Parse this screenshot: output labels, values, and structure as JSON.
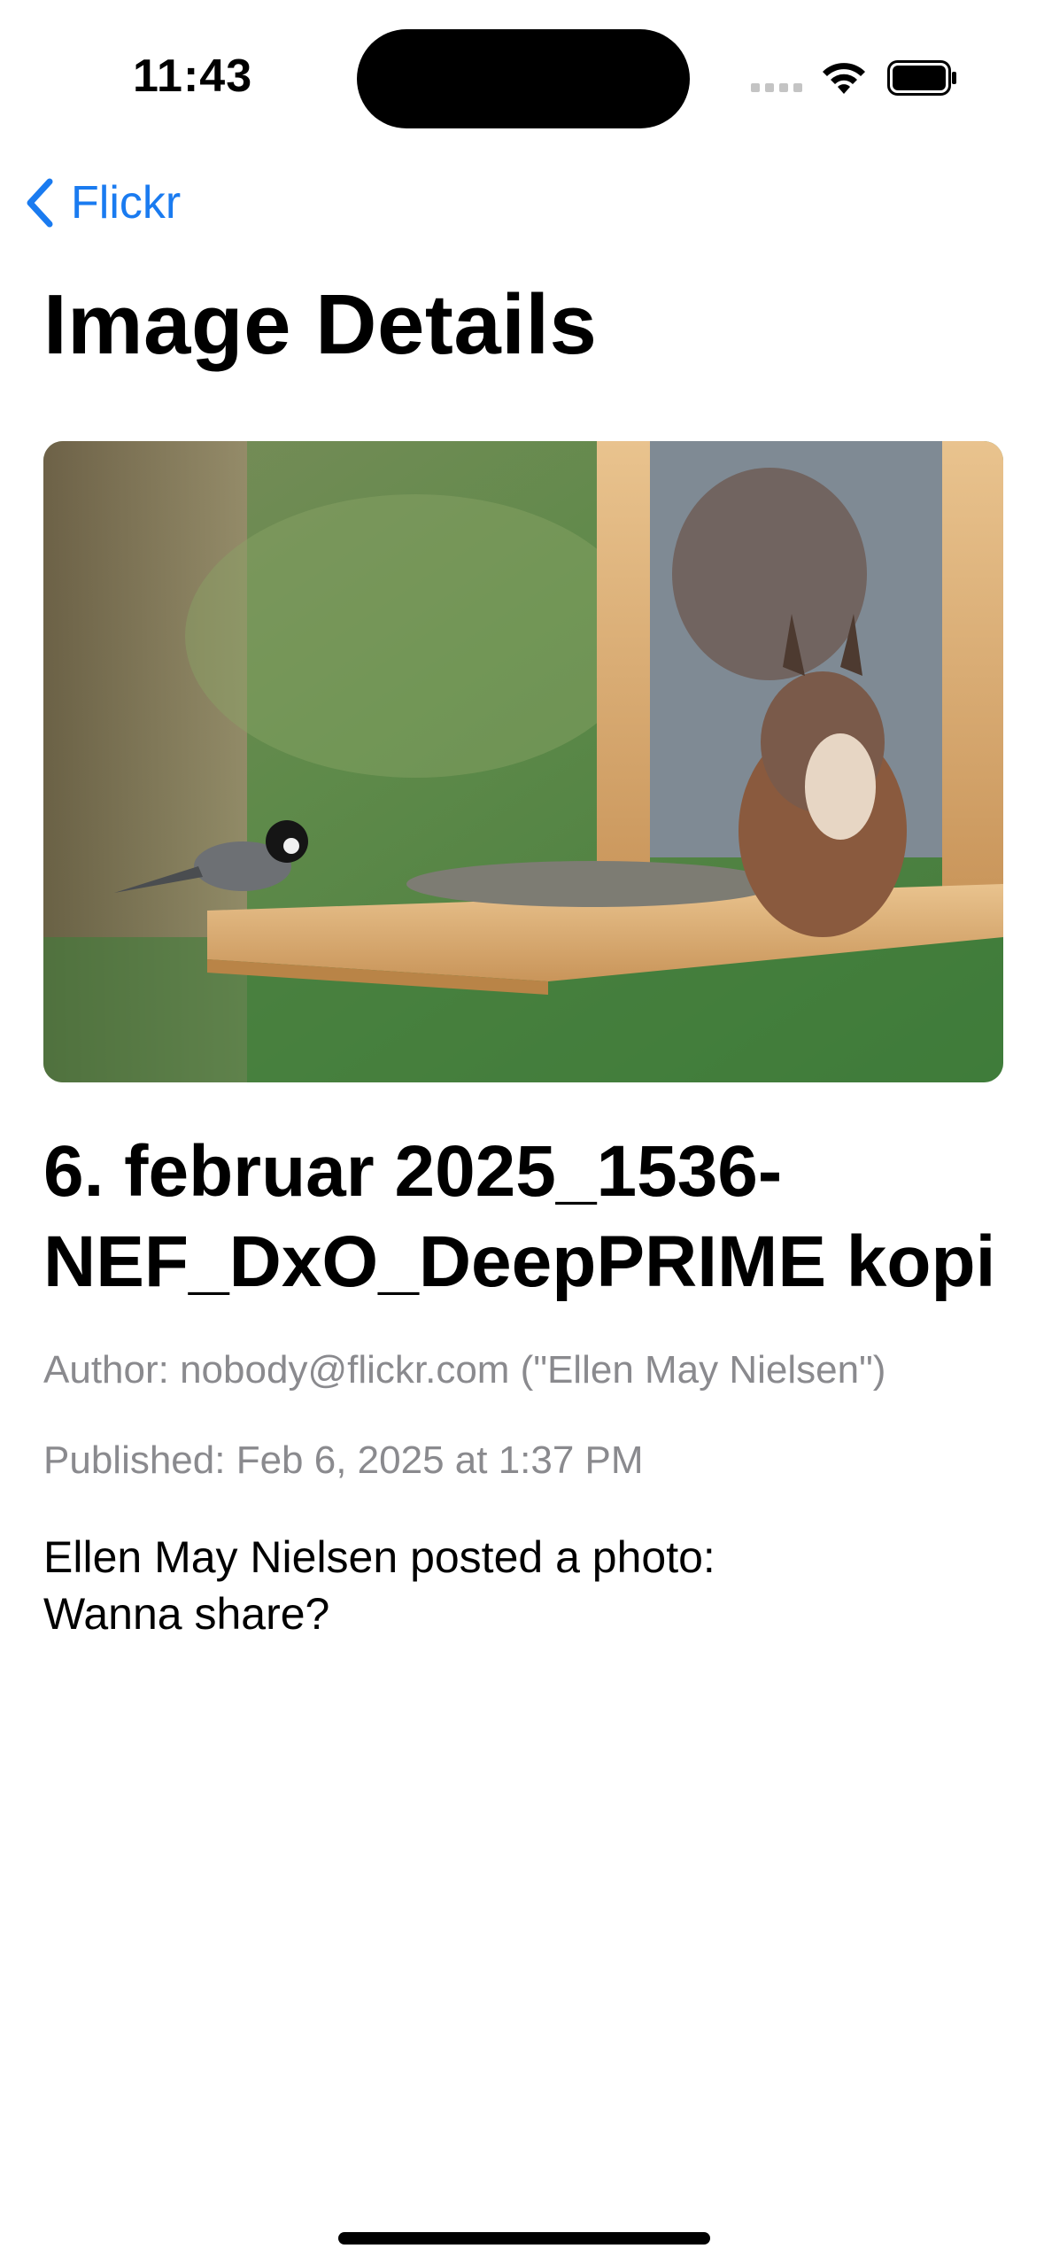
{
  "status_bar": {
    "time": "11:43",
    "icons": [
      "cellular-signal-icon",
      "wifi-icon",
      "battery-icon"
    ]
  },
  "nav": {
    "back_label": "Flickr",
    "back_icon": "chevron-left-icon",
    "accent_color": "#1a7bf0"
  },
  "page": {
    "title": "Image Details"
  },
  "image": {
    "description": "photo",
    "title": "6. februar 2025_1536-NEF_DxO_DeepPRIME kopi",
    "author": "Author: nobody@flickr.com (\"Ellen May Nielsen\")",
    "published": "Published: Feb 6, 2025 at 1:37 PM",
    "caption_line1": "Ellen May Nielsen posted a photo:",
    "caption_line2": "Wanna share?"
  }
}
